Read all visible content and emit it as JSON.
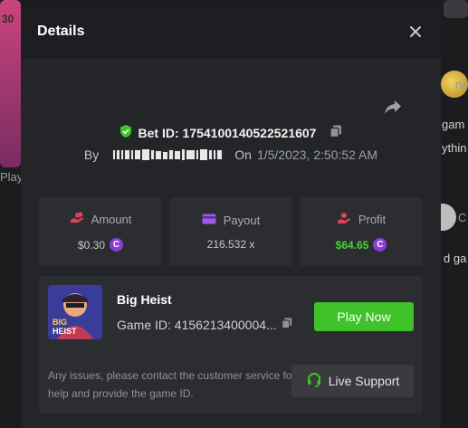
{
  "modal": {
    "title": "Details",
    "bet_id_text": "Bet ID: 1754100140522521607",
    "by_label": "By",
    "on_label": "On",
    "datetime": "1/5/2023, 2:50:52 AM"
  },
  "stats": [
    {
      "label": "Amount",
      "value": "$0.30",
      "icon": "money-hand-icon",
      "currency_icon": "coin-c-icon"
    },
    {
      "label": "Payout",
      "value": "216.532 x",
      "icon": "card-icon"
    },
    {
      "label": "Profit",
      "value": "$64.65",
      "icon": "profit-hand-icon",
      "currency_icon": "coin-c-icon"
    }
  ],
  "game": {
    "name": "Big Heist",
    "id_text": "Game ID: 4156213400004...",
    "thumb_text_1": "BIG",
    "thumb_text_2": "HEIST",
    "play_label": "Play Now",
    "issue_text": "Any issues, please contact the customer service for help and provide the game ID.",
    "support_label": "Live Support"
  },
  "background": {
    "left_number": "30",
    "left_play": "Play",
    "right_ga": "gam",
    "right_yth": "ythin",
    "right_c": "C",
    "right_d": "d ga",
    "right_ne": "ne"
  },
  "colors": {
    "accent_green": "#3fc22a",
    "profit_green": "#4cd137",
    "coin_purple": "#8a3dd8",
    "icon_pink": "#e0405a",
    "icon_purple": "#9b5de5",
    "shield_green": "#3fc22a"
  }
}
